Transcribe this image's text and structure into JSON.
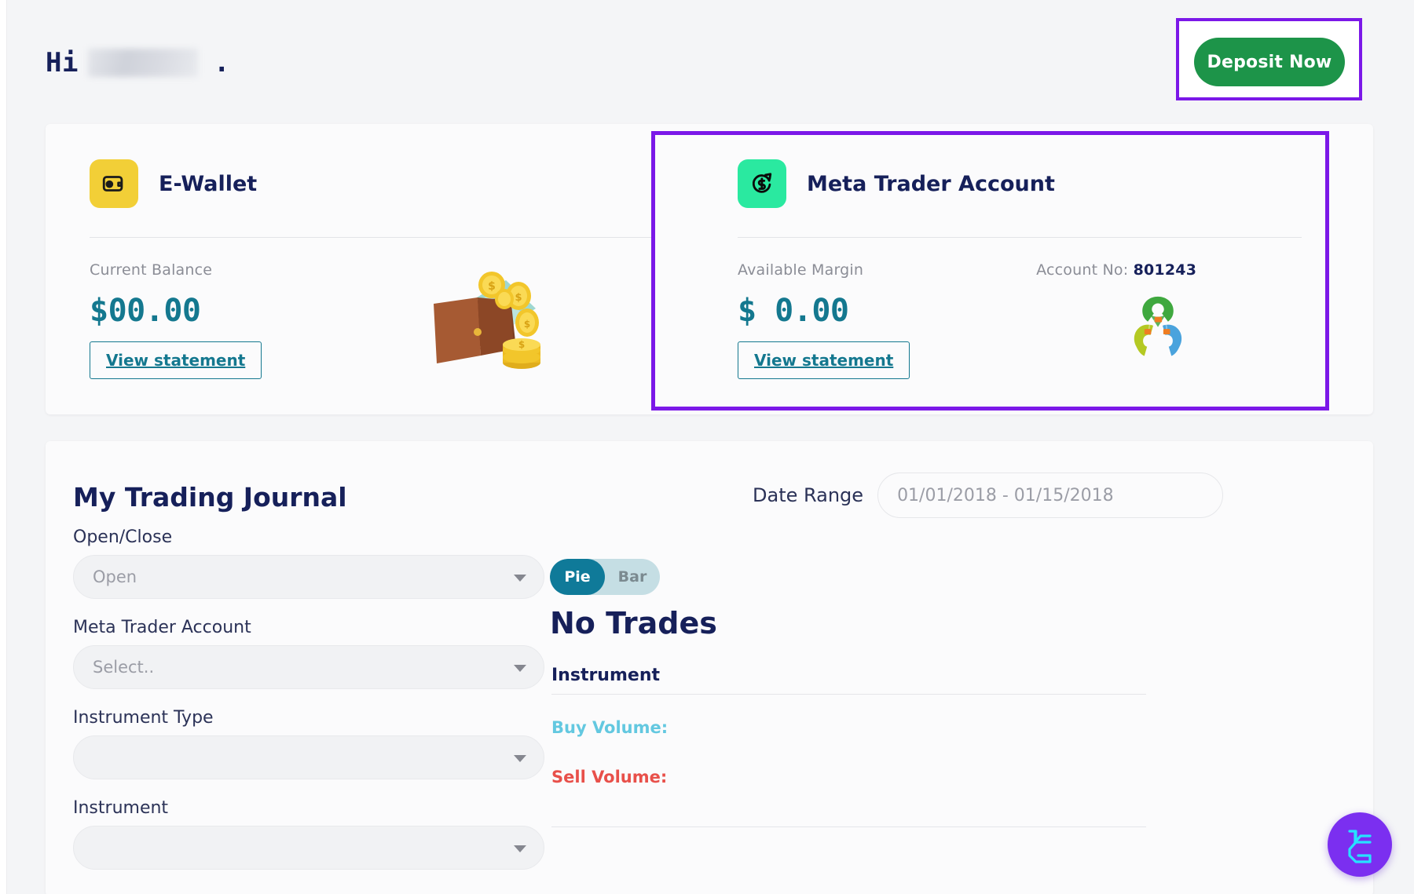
{
  "header": {
    "greeting_prefix": "Hi",
    "greeting_suffix": ".",
    "deposit_button": "Deposit Now"
  },
  "accounts": {
    "wallet": {
      "icon": "wallet-icon",
      "title": "E-Wallet",
      "balance_label": "Current Balance",
      "balance_value": "$00.00",
      "view_statement": "View statement",
      "badge_color": "#f2cf37"
    },
    "meta": {
      "icon": "dollar-growth-icon",
      "title": "Meta Trader Account",
      "margin_label": "Available Margin",
      "margin_value": "$ 0.00",
      "account_no_label": "Account No:",
      "account_no_value": "801243",
      "view_statement": "View statement",
      "badge_color": "#2ae9a0"
    }
  },
  "journal": {
    "title": "My Trading Journal",
    "fields": [
      {
        "label": "Open/Close",
        "value": "Open"
      },
      {
        "label": "Meta Trader Account",
        "value": "Select.."
      },
      {
        "label": "Instrument Type",
        "value": ""
      },
      {
        "label": "Instrument",
        "value": ""
      }
    ],
    "date_range_label": "Date Range",
    "date_range_value": "01/01/2018 - 01/15/2018",
    "chart_toggle": {
      "pie": "Pie",
      "bar": "Bar",
      "selected": "Pie"
    },
    "empty_state": "No Trades",
    "instrument_header": "Instrument",
    "buy_volume_label": "Buy Volume:",
    "sell_volume_label": "Sell Volume:",
    "buy_color": "#63c8e0",
    "sell_color": "#e8504a"
  },
  "fab": {
    "icon": "lc-logo-icon"
  },
  "highlights": {
    "color": "#7b18e8"
  }
}
